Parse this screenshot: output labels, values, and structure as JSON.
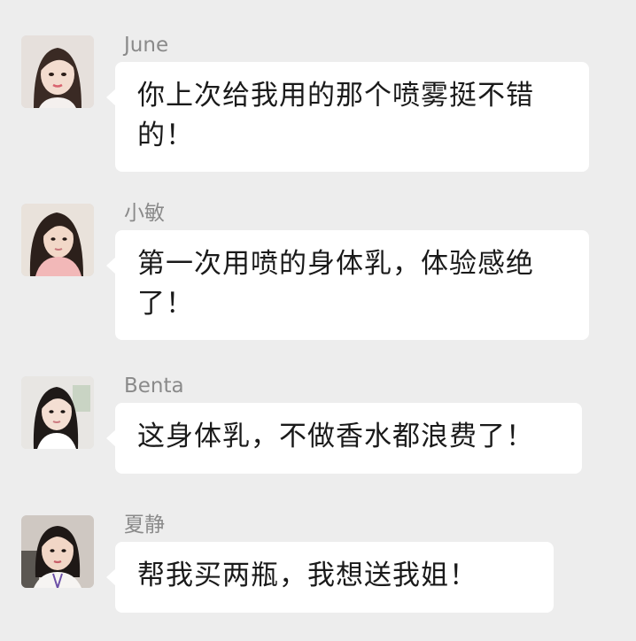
{
  "messages": [
    {
      "sender": "June",
      "text": "你上次给我用的那个喷雾挺不错的！",
      "avatar_icon": "woman-portrait-avatar"
    },
    {
      "sender": "小敏",
      "text": "第一次用喷的身体乳，体验感绝了！",
      "avatar_icon": "woman-portrait-avatar"
    },
    {
      "sender": "Benta",
      "text": "这身体乳，不做香水都浪费了！",
      "avatar_icon": "woman-portrait-avatar"
    },
    {
      "sender": "夏静",
      "text": "帮我买两瓶，我想送我姐！",
      "avatar_icon": "woman-portrait-avatar"
    }
  ],
  "colors": {
    "background": "#ededed",
    "bubble": "#ffffff",
    "sender_name": "#8a8a8a",
    "message_text": "#1a1a1a"
  }
}
